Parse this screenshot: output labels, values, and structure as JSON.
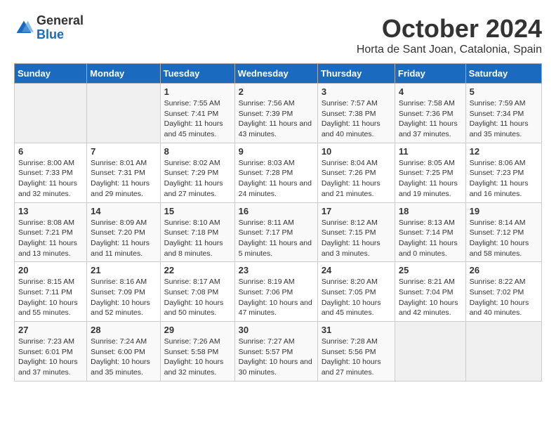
{
  "logo": {
    "general": "General",
    "blue": "Blue"
  },
  "title": "October 2024",
  "location": "Horta de Sant Joan, Catalonia, Spain",
  "days_of_week": [
    "Sunday",
    "Monday",
    "Tuesday",
    "Wednesday",
    "Thursday",
    "Friday",
    "Saturday"
  ],
  "weeks": [
    [
      {
        "day": "",
        "info": ""
      },
      {
        "day": "",
        "info": ""
      },
      {
        "day": "1",
        "info": "Sunrise: 7:55 AM\nSunset: 7:41 PM\nDaylight: 11 hours and 45 minutes."
      },
      {
        "day": "2",
        "info": "Sunrise: 7:56 AM\nSunset: 7:39 PM\nDaylight: 11 hours and 43 minutes."
      },
      {
        "day": "3",
        "info": "Sunrise: 7:57 AM\nSunset: 7:38 PM\nDaylight: 11 hours and 40 minutes."
      },
      {
        "day": "4",
        "info": "Sunrise: 7:58 AM\nSunset: 7:36 PM\nDaylight: 11 hours and 37 minutes."
      },
      {
        "day": "5",
        "info": "Sunrise: 7:59 AM\nSunset: 7:34 PM\nDaylight: 11 hours and 35 minutes."
      }
    ],
    [
      {
        "day": "6",
        "info": "Sunrise: 8:00 AM\nSunset: 7:33 PM\nDaylight: 11 hours and 32 minutes."
      },
      {
        "day": "7",
        "info": "Sunrise: 8:01 AM\nSunset: 7:31 PM\nDaylight: 11 hours and 29 minutes."
      },
      {
        "day": "8",
        "info": "Sunrise: 8:02 AM\nSunset: 7:29 PM\nDaylight: 11 hours and 27 minutes."
      },
      {
        "day": "9",
        "info": "Sunrise: 8:03 AM\nSunset: 7:28 PM\nDaylight: 11 hours and 24 minutes."
      },
      {
        "day": "10",
        "info": "Sunrise: 8:04 AM\nSunset: 7:26 PM\nDaylight: 11 hours and 21 minutes."
      },
      {
        "day": "11",
        "info": "Sunrise: 8:05 AM\nSunset: 7:25 PM\nDaylight: 11 hours and 19 minutes."
      },
      {
        "day": "12",
        "info": "Sunrise: 8:06 AM\nSunset: 7:23 PM\nDaylight: 11 hours and 16 minutes."
      }
    ],
    [
      {
        "day": "13",
        "info": "Sunrise: 8:08 AM\nSunset: 7:21 PM\nDaylight: 11 hours and 13 minutes."
      },
      {
        "day": "14",
        "info": "Sunrise: 8:09 AM\nSunset: 7:20 PM\nDaylight: 11 hours and 11 minutes."
      },
      {
        "day": "15",
        "info": "Sunrise: 8:10 AM\nSunset: 7:18 PM\nDaylight: 11 hours and 8 minutes."
      },
      {
        "day": "16",
        "info": "Sunrise: 8:11 AM\nSunset: 7:17 PM\nDaylight: 11 hours and 5 minutes."
      },
      {
        "day": "17",
        "info": "Sunrise: 8:12 AM\nSunset: 7:15 PM\nDaylight: 11 hours and 3 minutes."
      },
      {
        "day": "18",
        "info": "Sunrise: 8:13 AM\nSunset: 7:14 PM\nDaylight: 11 hours and 0 minutes."
      },
      {
        "day": "19",
        "info": "Sunrise: 8:14 AM\nSunset: 7:12 PM\nDaylight: 10 hours and 58 minutes."
      }
    ],
    [
      {
        "day": "20",
        "info": "Sunrise: 8:15 AM\nSunset: 7:11 PM\nDaylight: 10 hours and 55 minutes."
      },
      {
        "day": "21",
        "info": "Sunrise: 8:16 AM\nSunset: 7:09 PM\nDaylight: 10 hours and 52 minutes."
      },
      {
        "day": "22",
        "info": "Sunrise: 8:17 AM\nSunset: 7:08 PM\nDaylight: 10 hours and 50 minutes."
      },
      {
        "day": "23",
        "info": "Sunrise: 8:19 AM\nSunset: 7:06 PM\nDaylight: 10 hours and 47 minutes."
      },
      {
        "day": "24",
        "info": "Sunrise: 8:20 AM\nSunset: 7:05 PM\nDaylight: 10 hours and 45 minutes."
      },
      {
        "day": "25",
        "info": "Sunrise: 8:21 AM\nSunset: 7:04 PM\nDaylight: 10 hours and 42 minutes."
      },
      {
        "day": "26",
        "info": "Sunrise: 8:22 AM\nSunset: 7:02 PM\nDaylight: 10 hours and 40 minutes."
      }
    ],
    [
      {
        "day": "27",
        "info": "Sunrise: 7:23 AM\nSunset: 6:01 PM\nDaylight: 10 hours and 37 minutes."
      },
      {
        "day": "28",
        "info": "Sunrise: 7:24 AM\nSunset: 6:00 PM\nDaylight: 10 hours and 35 minutes."
      },
      {
        "day": "29",
        "info": "Sunrise: 7:26 AM\nSunset: 5:58 PM\nDaylight: 10 hours and 32 minutes."
      },
      {
        "day": "30",
        "info": "Sunrise: 7:27 AM\nSunset: 5:57 PM\nDaylight: 10 hours and 30 minutes."
      },
      {
        "day": "31",
        "info": "Sunrise: 7:28 AM\nSunset: 5:56 PM\nDaylight: 10 hours and 27 minutes."
      },
      {
        "day": "",
        "info": ""
      },
      {
        "day": "",
        "info": ""
      }
    ]
  ]
}
